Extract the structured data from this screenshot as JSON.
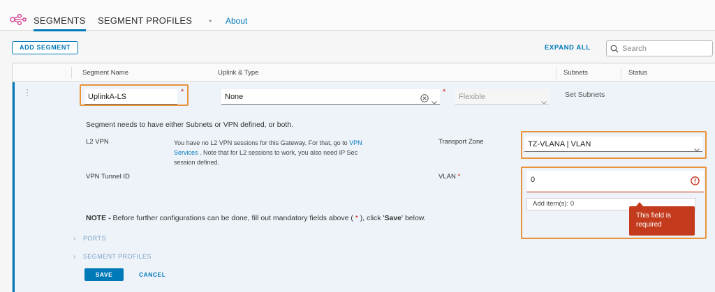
{
  "nav": {
    "tabs": [
      {
        "label": "SEGMENTS",
        "active": true
      },
      {
        "label": "SEGMENT PROFILES",
        "active": false
      }
    ],
    "separator": "•",
    "about": "About"
  },
  "toolbar": {
    "add_segment": "ADD SEGMENT",
    "expand_all": "EXPAND ALL",
    "search_placeholder": "Search"
  },
  "grid": {
    "columns": [
      "Segment Name",
      "Uplink & Type",
      "Subnets",
      "Status"
    ]
  },
  "segment": {
    "name": "UplinkA-LS",
    "required_mark": "*",
    "uplink": "None",
    "type": "Flexible",
    "set_subnets": "Set Subnets",
    "message": "Segment needs to have either Subnets or VPN defined, or both.",
    "l2vpn": {
      "label": "L2 VPN",
      "text_before_link": "You have no L2 VPN sessions for this Gateway. For that, go to",
      "link": "VPN Services",
      "text_after_link": ". Note that for L2 sessions to work, you also need IP Sec session defined."
    },
    "vpn_tunnel_id_label": "VPN Tunnel ID",
    "transport_zone": {
      "label": "Transport Zone",
      "value": "TZ-VLANA | VLAN"
    },
    "vlan": {
      "label": "VLAN",
      "value": "0",
      "add_items": "Add item(s): 0",
      "error": "This field is required"
    },
    "note": {
      "prefix": "NOTE -",
      "text_1": " Before further configurations can be done, fill out mandatory fields above ( ",
      "asterisk": "*",
      "text_2": " ), click '",
      "save_word": "Save",
      "text_3": "' below."
    },
    "sections": [
      "PORTS",
      "SEGMENT PROFILES"
    ],
    "save": "SAVE",
    "cancel": "CANCEL"
  },
  "colors": {
    "accent": "#0079b8",
    "highlight": "#e8923a",
    "error": "#c33a1c",
    "required": "#c21d00"
  }
}
